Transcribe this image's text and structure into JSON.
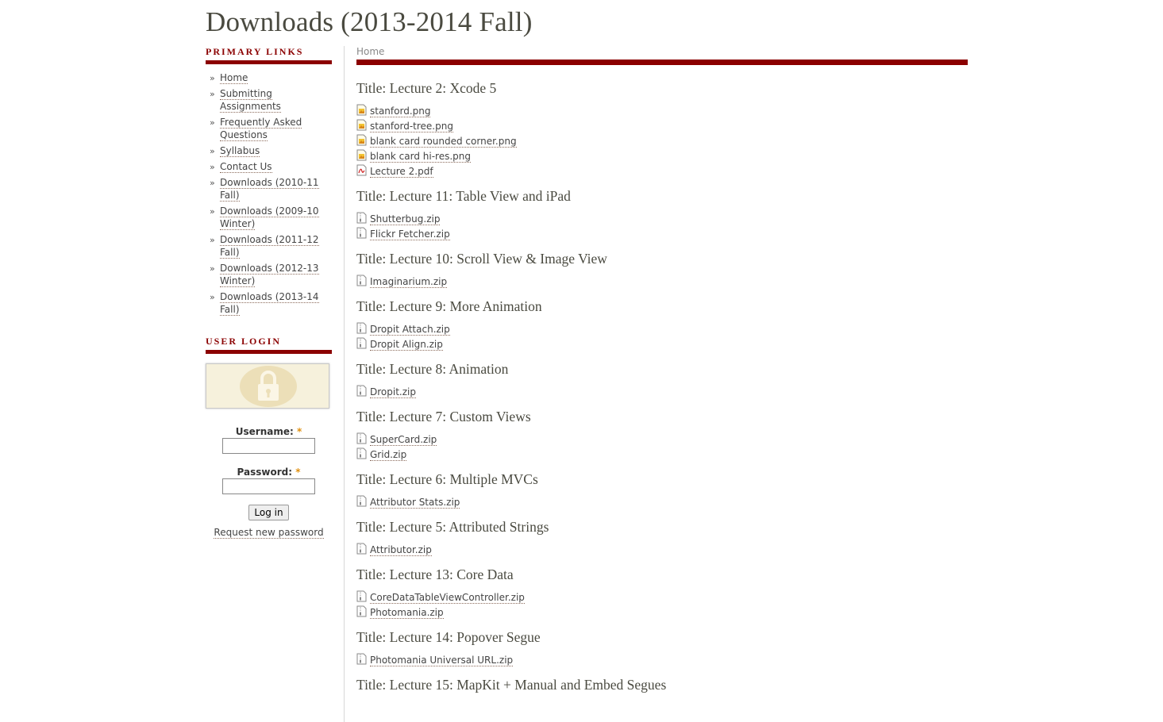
{
  "site": {
    "title": "Downloads (2013-2014 Fall)"
  },
  "sidebar": {
    "primary_links": {
      "title": "PRIMARY LINKS",
      "items": [
        "Home",
        "Submitting Assignments",
        "Frequently Asked Questions",
        "Syllabus",
        "Contact Us",
        "Downloads (2010-11 Fall)",
        "Downloads (2009-10 Winter)",
        "Downloads (2011-12 Fall)",
        "Downloads (2012-13 Winter)",
        "Downloads (2013-14 Fall)"
      ]
    },
    "user_login": {
      "title": "USER LOGIN",
      "username_label": "Username:",
      "password_label": "Password:",
      "required_mark": "*",
      "login_button": "Log in",
      "request_password": "Request new password"
    }
  },
  "breadcrumb": "Home",
  "lectures": [
    {
      "title": "Title: Lecture 2: Xcode 5",
      "files": [
        {
          "name": "stanford.png",
          "icon": "image-icon"
        },
        {
          "name": "stanford-tree.png",
          "icon": "image-icon"
        },
        {
          "name": "blank card rounded corner.png",
          "icon": "image-icon"
        },
        {
          "name": "blank card hi-res.png",
          "icon": "image-icon"
        },
        {
          "name": "Lecture 2.pdf",
          "icon": "pdf-icon"
        }
      ]
    },
    {
      "title": "Title: Lecture 11: Table View and iPad",
      "files": [
        {
          "name": "Shutterbug.zip",
          "icon": "zip-icon"
        },
        {
          "name": "Flickr Fetcher.zip",
          "icon": "zip-icon"
        }
      ]
    },
    {
      "title": "Title: Lecture 10: Scroll View & Image View",
      "files": [
        {
          "name": "Imaginarium.zip",
          "icon": "zip-icon"
        }
      ]
    },
    {
      "title": "Title: Lecture 9: More Animation",
      "files": [
        {
          "name": "Dropit Attach.zip",
          "icon": "zip-icon"
        },
        {
          "name": "Dropit Align.zip",
          "icon": "zip-icon"
        }
      ]
    },
    {
      "title": "Title: Lecture 8: Animation",
      "files": [
        {
          "name": "Dropit.zip",
          "icon": "zip-icon"
        }
      ]
    },
    {
      "title": "Title: Lecture 7: Custom Views",
      "files": [
        {
          "name": "SuperCard.zip",
          "icon": "zip-icon"
        },
        {
          "name": "Grid.zip",
          "icon": "zip-icon"
        }
      ]
    },
    {
      "title": "Title: Lecture 6: Multiple MVCs",
      "files": [
        {
          "name": "Attributor Stats.zip",
          "icon": "zip-icon"
        }
      ]
    },
    {
      "title": "Title: Lecture 5: Attributed Strings",
      "files": [
        {
          "name": "Attributor.zip",
          "icon": "zip-icon"
        }
      ]
    },
    {
      "title": "Title: Lecture 13: Core Data",
      "files": [
        {
          "name": "CoreDataTableViewController.zip",
          "icon": "zip-icon"
        },
        {
          "name": "Photomania.zip",
          "icon": "zip-icon"
        }
      ]
    },
    {
      "title": "Title: Lecture 14: Popover Segue",
      "files": [
        {
          "name": "Photomania Universal URL.zip",
          "icon": "zip-icon"
        }
      ]
    },
    {
      "title": "Title: Lecture 15: MapKit + Manual and Embed Segues",
      "files": []
    }
  ],
  "colors": {
    "accent": "#8b0000",
    "heading": "#4a4a40"
  }
}
